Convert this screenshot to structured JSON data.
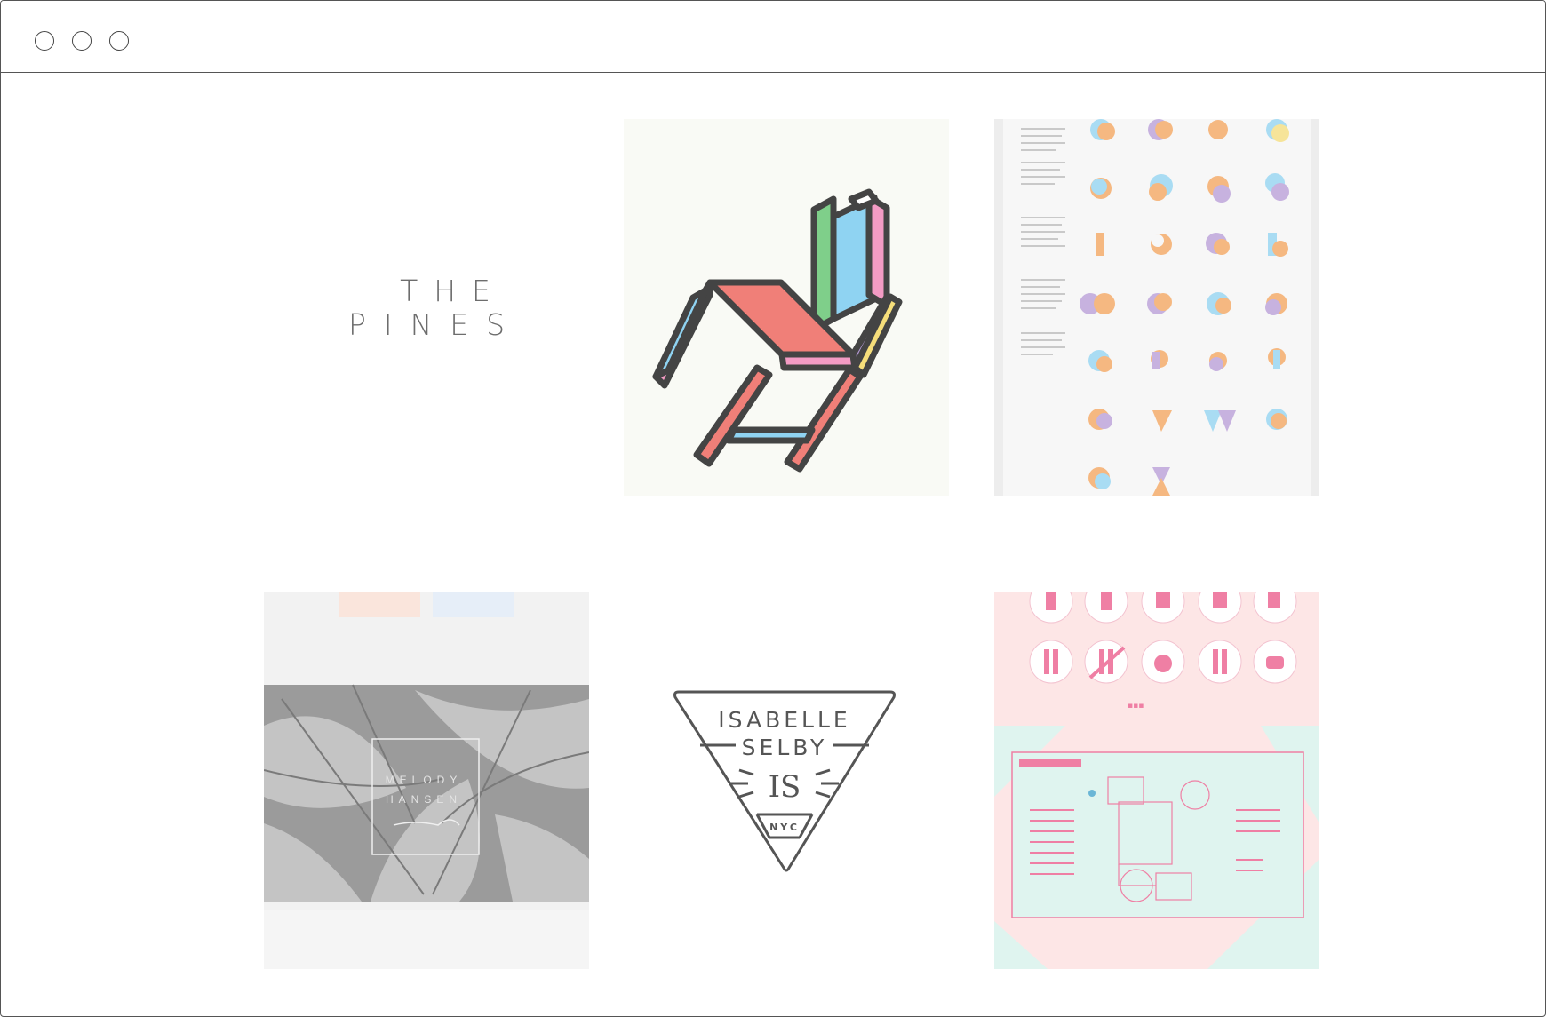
{
  "window": {
    "controls": [
      "close",
      "minimize",
      "maximize"
    ]
  },
  "gallery": {
    "items": [
      {
        "name": "the-pines-logo",
        "line1": "THE",
        "line2": "PINES"
      },
      {
        "name": "isometric-chair-illustration"
      },
      {
        "name": "alphabet-poster"
      },
      {
        "name": "melody-hansen-branding",
        "line1": "MELODY",
        "line2": "HANSEN"
      },
      {
        "name": "isabelle-selby-badge",
        "line1": "ISABELLE",
        "line2": "SELBY",
        "monogram": "IS",
        "city": "NYC"
      },
      {
        "name": "wayfinding-poster"
      }
    ]
  },
  "colors": {
    "chair_red": "#f07f78",
    "chair_blue": "#8fd3f2",
    "chair_green": "#7fcf8a",
    "chair_pink": "#f39bc4",
    "chair_purple": "#b79bd8",
    "chair_yellow": "#f6de7a",
    "outline": "#444444",
    "wayfinding_pink": "#ef7fa4",
    "wayfinding_mint": "#dff4ef"
  }
}
